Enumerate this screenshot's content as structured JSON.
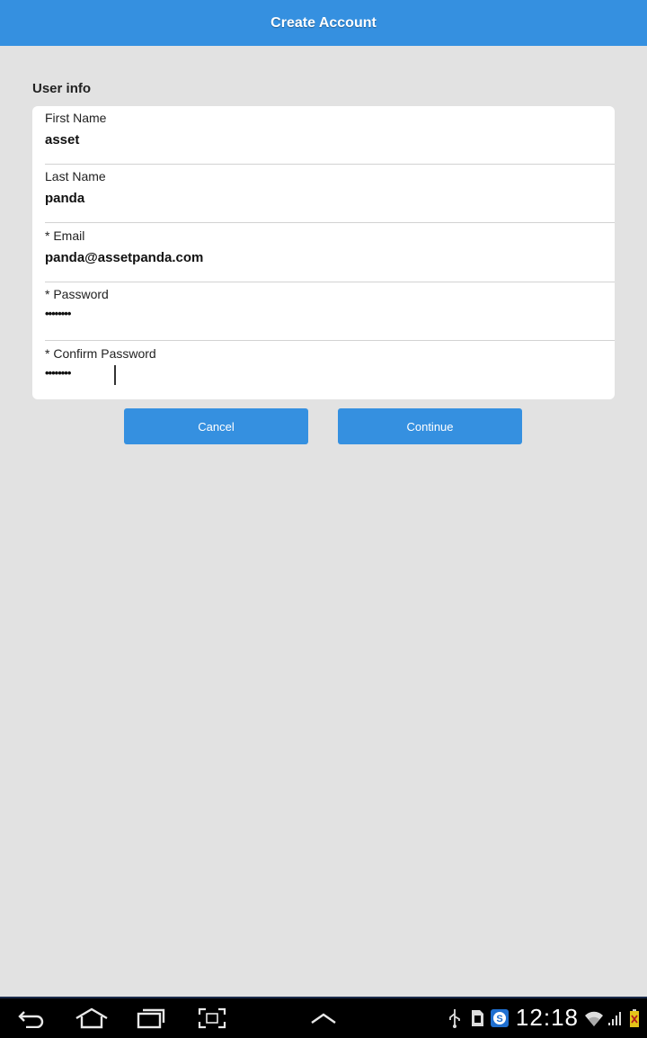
{
  "header": {
    "title": "Create Account"
  },
  "section": {
    "title": "User info"
  },
  "form": {
    "first_name": {
      "label": "First Name",
      "value": "asset"
    },
    "last_name": {
      "label": "Last Name",
      "value": "panda"
    },
    "email": {
      "label": "* Email",
      "value": "panda@assetpanda.com"
    },
    "password": {
      "label": "* Password",
      "value": "••••••••"
    },
    "confirm_password": {
      "label": "* Confirm Password",
      "value": "••••••••"
    }
  },
  "buttons": {
    "cancel": "Cancel",
    "continue": "Continue"
  },
  "system_bar": {
    "time": "12:18",
    "nav_icons": [
      "back-icon",
      "home-icon",
      "recent-apps-icon",
      "screenshot-icon",
      "up-chevron-icon"
    ],
    "status_icons": [
      "usb-icon",
      "sd-card-icon",
      "skype-icon",
      "wifi-icon",
      "signal-icon",
      "battery-icon"
    ]
  },
  "colors": {
    "accent": "#3590e0",
    "background": "#e2e2e2",
    "card": "#ffffff"
  }
}
